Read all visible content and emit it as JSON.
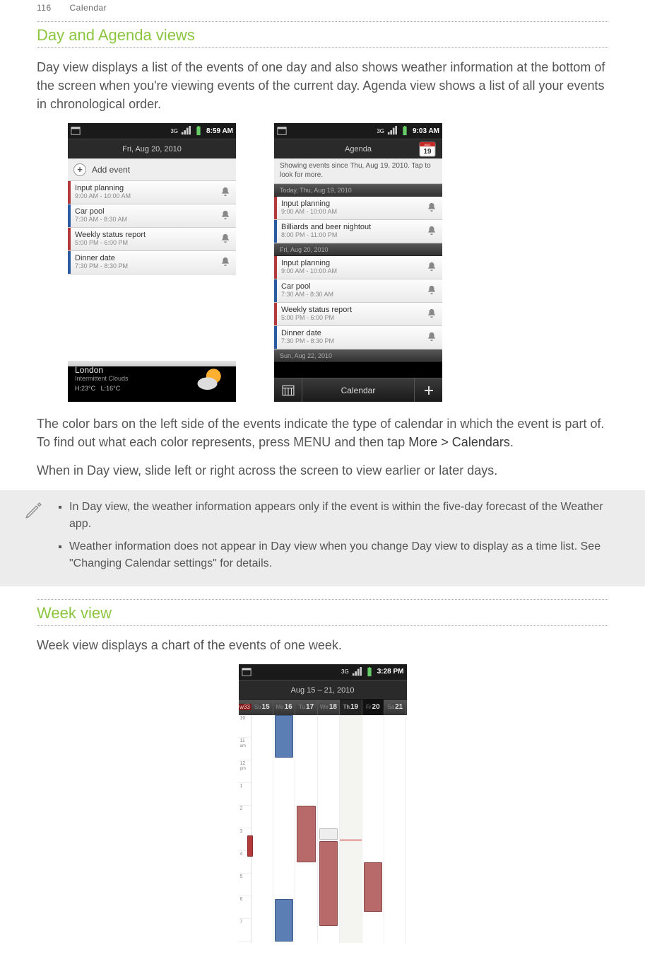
{
  "header": {
    "page_num": "116",
    "section": "Calendar"
  },
  "s1": {
    "title": "Day and Agenda views",
    "p1": "Day view displays a list of the events of one day and also shows weather information at the bottom of the screen when you're viewing events of the current day. Agenda view shows a list of all your events in chronological order.",
    "p2a": "The color bars on the left side of the events indicate the type of calendar in which the event is part of. To find out what each color represents, press MENU and then tap ",
    "p2b": "More > Calendars",
    "p2c": ".",
    "p3": "When in Day view, slide left or right across the screen to view earlier or later days."
  },
  "dayshot": {
    "time": "8:59 AM",
    "title": "Fri, Aug 20, 2010",
    "add": "Add event",
    "events": [
      {
        "t": "Input planning",
        "tm": "9:00 AM - 10:00 AM",
        "c": "#b23a3a"
      },
      {
        "t": "Car pool",
        "tm": "7:30 AM - 8:30 AM",
        "c": "#2c5aa0"
      },
      {
        "t": "Weekly status report",
        "tm": "5:00 PM - 6:00 PM",
        "c": "#b23a3a"
      },
      {
        "t": "Dinner date",
        "tm": "7:30 PM - 8:30 PM",
        "c": "#2c5aa0"
      }
    ],
    "weather": {
      "city": "London",
      "cond": "Intermittent Clouds",
      "hi": "23°C",
      "lo": "16°C",
      "hlabel": "H:",
      "llabel": "L:"
    }
  },
  "agendashot": {
    "time": "9:03 AM",
    "title": "Agenda",
    "info": "Showing events since Thu, Aug 19, 2010. Tap to look for more.",
    "bottom_label": "Calendar",
    "groups": [
      {
        "label": "Today, Thu, Aug 19, 2010",
        "events": [
          {
            "t": "Input planning",
            "tm": "9:00 AM - 10:00 AM",
            "c": "#b23a3a"
          },
          {
            "t": "Billiards and beer nightout",
            "tm": "8:00 PM - 11:00 PM",
            "c": "#2c5aa0"
          }
        ]
      },
      {
        "label": "Fri, Aug 20, 2010",
        "events": [
          {
            "t": "Input planning",
            "tm": "9:00 AM - 10:00 AM",
            "c": "#b23a3a"
          },
          {
            "t": "Car pool",
            "tm": "7:30 AM - 8:30 AM",
            "c": "#2c5aa0"
          },
          {
            "t": "Weekly status report",
            "tm": "5:00 PM - 6:00 PM",
            "c": "#b23a3a"
          },
          {
            "t": "Dinner date",
            "tm": "7:30 PM - 8:30 PM",
            "c": "#2c5aa0"
          }
        ]
      },
      {
        "label": "Sun, Aug 22, 2010",
        "events": []
      }
    ]
  },
  "notes": {
    "n1": "In Day view, the weather information appears only if the event is within the five-day forecast of the Weather app.",
    "n2": "Weather information does not appear in Day view when you change Day view to display as a time list. See \"Changing Calendar settings\" for details."
  },
  "s2": {
    "title": "Week view",
    "p1": "Week view displays a chart of the events of one week."
  },
  "weekshot": {
    "time": "3:28 PM",
    "title": "Aug 15 – 21, 2010",
    "wknum": "w33",
    "days": [
      {
        "d": "Su",
        "n": "15"
      },
      {
        "d": "Mo",
        "n": "16"
      },
      {
        "d": "Tu",
        "n": "17"
      },
      {
        "d": "We",
        "n": "18"
      },
      {
        "d": "Th",
        "n": "19"
      },
      {
        "d": "Fr",
        "n": "20"
      },
      {
        "d": "Sa",
        "n": "21"
      }
    ],
    "hours": [
      "10",
      "11",
      "am",
      "12",
      "pm",
      "1",
      "2",
      "3",
      "4",
      "5",
      "6",
      "7"
    ]
  }
}
